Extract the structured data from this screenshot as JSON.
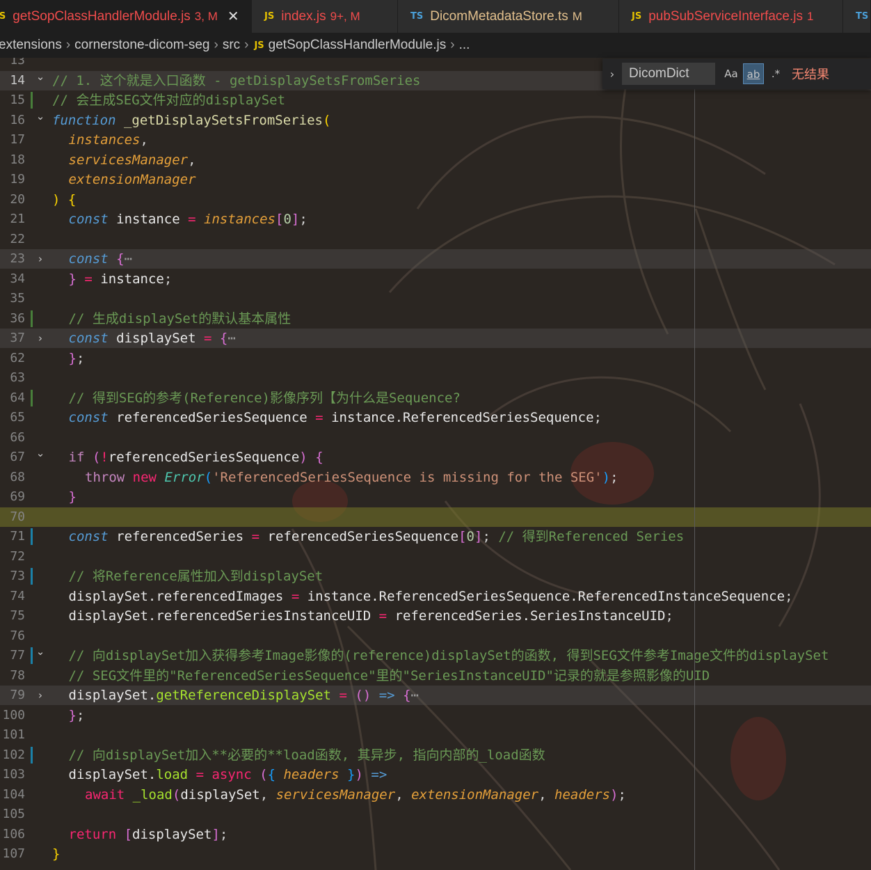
{
  "tabs": [
    {
      "icon": "JS",
      "name": "getSopClassHandlerModule.js",
      "status": "3, M",
      "state": "err",
      "active": true,
      "closable": true
    },
    {
      "icon": "JS",
      "name": "index.js",
      "status": "9+, M",
      "state": "err",
      "active": false
    },
    {
      "icon": "TS",
      "name": "DicomMetadataStore.ts",
      "status": "M",
      "state": "mod",
      "active": false
    },
    {
      "icon": "JS",
      "name": "pubSubServiceInterface.js",
      "status": "1",
      "state": "err",
      "active": false
    },
    {
      "icon": "TS",
      "name": "",
      "status": "",
      "state": "mod",
      "active": false
    }
  ],
  "tab_close_glyph": "✕",
  "breadcrumb": {
    "items": [
      "extensions",
      "cornerstone-dicom-seg",
      "src"
    ],
    "file_icon": "JS",
    "file": "getSopClassHandlerModule.js",
    "separator": "›",
    "trailing": "..."
  },
  "find_widget": {
    "query": "DicomDict",
    "match_case_label": "Aa",
    "whole_word_label": "ab",
    "regex_label": ".*",
    "result_text": "无结果",
    "expand_icon": "chevron-right-icon"
  },
  "colors": {
    "editor_bg": "#1e1e1e",
    "accent": "#007acc",
    "error_tab": "#f14c4c",
    "modified_tab": "#e2c08d"
  },
  "editor": {
    "current_line": 14,
    "lines": [
      {
        "n": "13",
        "cls": "partial",
        "tokens": []
      },
      {
        "n": "14",
        "fold": "open",
        "hl": "hl",
        "tokens": [
          [
            "t-cm",
            "// 1. 这个就是入口函数 - getDisplaySetsFromSeries"
          ]
        ]
      },
      {
        "n": "15",
        "gm": "add",
        "tokens": [
          [
            "t-cm",
            "// 会生成SEG文件对应的displaySet"
          ]
        ]
      },
      {
        "n": "16",
        "fold": "open",
        "tokens": [
          [
            "t-kw",
            "function"
          ],
          [
            "t-op",
            " "
          ],
          [
            "t-fn",
            "_getDisplaySetsFromSeries"
          ],
          [
            "t-br1",
            "("
          ]
        ]
      },
      {
        "n": "17",
        "ind": 1,
        "tokens": [
          [
            "t-prm",
            "instances"
          ],
          [
            "t-op",
            ","
          ]
        ]
      },
      {
        "n": "18",
        "ind": 1,
        "tokens": [
          [
            "t-prm",
            "servicesManager"
          ],
          [
            "t-op",
            ","
          ]
        ]
      },
      {
        "n": "19",
        "ind": 1,
        "tokens": [
          [
            "t-prm",
            "extensionManager"
          ]
        ]
      },
      {
        "n": "20",
        "tokens": [
          [
            "t-br1",
            ")"
          ],
          [
            "t-op",
            " "
          ],
          [
            "t-br1",
            "{"
          ]
        ]
      },
      {
        "n": "21",
        "ind": 1,
        "tokens": [
          [
            "t-kw",
            "const"
          ],
          [
            "t-op",
            " "
          ],
          [
            "t-var",
            "instance"
          ],
          [
            "t-op",
            " "
          ],
          [
            "t-pink",
            "="
          ],
          [
            "t-op",
            " "
          ],
          [
            "t-prm",
            "instances"
          ],
          [
            "t-br2",
            "["
          ],
          [
            "t-num",
            "0"
          ],
          [
            "t-br2",
            "]"
          ],
          [
            "t-op",
            ";"
          ]
        ]
      },
      {
        "n": "22",
        "ind": 1,
        "tokens": []
      },
      {
        "n": "23",
        "fold": "closed",
        "hl": "hl",
        "ind": 1,
        "tokens": [
          [
            "t-kw",
            "const"
          ],
          [
            "t-op",
            " "
          ],
          [
            "t-br2",
            "{"
          ],
          [
            "ellip",
            "⋯"
          ]
        ]
      },
      {
        "n": "34",
        "ind": 1,
        "tokens": [
          [
            "t-br2",
            "}"
          ],
          [
            "t-op",
            " "
          ],
          [
            "t-pink",
            "="
          ],
          [
            "t-op",
            " "
          ],
          [
            "t-var",
            "instance"
          ],
          [
            "t-op",
            ";"
          ]
        ]
      },
      {
        "n": "35",
        "ind": 1,
        "tokens": []
      },
      {
        "n": "36",
        "gm": "add",
        "ind": 1,
        "tokens": [
          [
            "t-cm",
            "// 生成displaySet的默认基本属性"
          ]
        ]
      },
      {
        "n": "37",
        "fold": "closed",
        "hl": "hl",
        "ind": 1,
        "tokens": [
          [
            "t-kw",
            "const"
          ],
          [
            "t-op",
            " "
          ],
          [
            "t-var",
            "displaySet"
          ],
          [
            "t-op",
            " "
          ],
          [
            "t-pink",
            "="
          ],
          [
            "t-op",
            " "
          ],
          [
            "t-br2",
            "{"
          ],
          [
            "ellip",
            "⋯"
          ]
        ]
      },
      {
        "n": "62",
        "ind": 1,
        "tokens": [
          [
            "t-br2",
            "}"
          ],
          [
            "t-op",
            ";"
          ]
        ]
      },
      {
        "n": "63",
        "ind": 1,
        "tokens": []
      },
      {
        "n": "64",
        "gm": "add",
        "ind": 1,
        "tokens": [
          [
            "t-cm",
            "// 得到SEG的参考(Reference)影像序列【为什么是Sequence?"
          ]
        ]
      },
      {
        "n": "65",
        "ind": 1,
        "tokens": [
          [
            "t-kw",
            "const"
          ],
          [
            "t-op",
            " "
          ],
          [
            "t-var",
            "referencedSeriesSequence"
          ],
          [
            "t-op",
            " "
          ],
          [
            "t-pink",
            "="
          ],
          [
            "t-op",
            " "
          ],
          [
            "t-var",
            "instance.ReferencedSeriesSequence"
          ],
          [
            "t-op",
            ";"
          ]
        ]
      },
      {
        "n": "66",
        "ind": 1,
        "tokens": []
      },
      {
        "n": "67",
        "fold": "open",
        "ind": 1,
        "tokens": [
          [
            "t-ctl",
            "if"
          ],
          [
            "t-op",
            " "
          ],
          [
            "t-br2",
            "("
          ],
          [
            "t-pink",
            "!"
          ],
          [
            "t-var",
            "referencedSeriesSequence"
          ],
          [
            "t-br2",
            ")"
          ],
          [
            "t-op",
            " "
          ],
          [
            "t-br2",
            "{"
          ]
        ]
      },
      {
        "n": "68",
        "ind": 2,
        "tokens": [
          [
            "t-ctl",
            "throw"
          ],
          [
            "t-op",
            " "
          ],
          [
            "t-red",
            "new"
          ],
          [
            "t-op",
            " "
          ],
          [
            "t-cls",
            "Error"
          ],
          [
            "t-br3",
            "("
          ],
          [
            "t-str",
            "'ReferencedSeriesSequence is missing for the SEG'"
          ],
          [
            "t-br3",
            ")"
          ],
          [
            "t-op",
            ";"
          ]
        ]
      },
      {
        "n": "69",
        "ind": 1,
        "tokens": [
          [
            "t-br2",
            "}"
          ]
        ]
      },
      {
        "n": "70",
        "hl": "yhl",
        "tokens": []
      },
      {
        "n": "71",
        "gm": "mod",
        "ind": 1,
        "tokens": [
          [
            "t-kw",
            "const"
          ],
          [
            "t-op",
            " "
          ],
          [
            "t-var",
            "referencedSeries"
          ],
          [
            "t-op",
            " "
          ],
          [
            "t-pink",
            "="
          ],
          [
            "t-op",
            " "
          ],
          [
            "t-var",
            "referencedSeriesSequence"
          ],
          [
            "t-br2",
            "["
          ],
          [
            "t-num",
            "0"
          ],
          [
            "t-br2",
            "]"
          ],
          [
            "t-op",
            ";"
          ],
          [
            "t-op",
            " "
          ],
          [
            "t-cm",
            "// 得到Referenced Series"
          ]
        ]
      },
      {
        "n": "72",
        "ind": 1,
        "tokens": []
      },
      {
        "n": "73",
        "gm": "mod",
        "ind": 1,
        "tokens": [
          [
            "t-cm",
            "// 将Reference属性加入到displaySet"
          ]
        ]
      },
      {
        "n": "74",
        "ind": 1,
        "tokens": [
          [
            "t-var",
            "displaySet.referencedImages"
          ],
          [
            "t-op",
            " "
          ],
          [
            "t-pink",
            "="
          ],
          [
            "t-op",
            " "
          ],
          [
            "t-var",
            "instance.ReferencedSeriesSequence.ReferencedInstanceSequence"
          ],
          [
            "t-op",
            ";"
          ]
        ]
      },
      {
        "n": "75",
        "ind": 1,
        "tokens": [
          [
            "t-var",
            "displaySet.referencedSeriesInstanceUID"
          ],
          [
            "t-op",
            " "
          ],
          [
            "t-pink",
            "="
          ],
          [
            "t-op",
            " "
          ],
          [
            "t-var",
            "referencedSeries.SeriesInstanceUID"
          ],
          [
            "t-op",
            ";"
          ]
        ]
      },
      {
        "n": "76",
        "ind": 1,
        "tokens": []
      },
      {
        "n": "77",
        "fold": "open",
        "gm": "mod",
        "ind": 1,
        "tokens": [
          [
            "t-cm",
            "// 向displaySet加入获得参考Image影像的(reference)displaySet的函数, 得到SEG文件参考Image文件的displaySet"
          ]
        ]
      },
      {
        "n": "78",
        "ind": 1,
        "tokens": [
          [
            "t-cm",
            "// SEG文件里的\"ReferencedSeriesSequence\"里的\"SeriesInstanceUID\"记录的就是参照影像的UID"
          ]
        ]
      },
      {
        "n": "79",
        "fold": "closed",
        "hl": "hl",
        "ind": 1,
        "tokens": [
          [
            "t-var",
            "displaySet."
          ],
          [
            "t-grn",
            "getReferenceDisplaySet"
          ],
          [
            "t-op",
            " "
          ],
          [
            "t-pink",
            "="
          ],
          [
            "t-op",
            " "
          ],
          [
            "t-br2",
            "()"
          ],
          [
            "t-op",
            " "
          ],
          [
            "t-kw",
            "=>"
          ],
          [
            "t-op",
            " "
          ],
          [
            "t-br2",
            "{"
          ],
          [
            "ellip",
            "⋯"
          ]
        ]
      },
      {
        "n": "100",
        "ind": 1,
        "tokens": [
          [
            "t-br2",
            "}"
          ],
          [
            "t-op",
            ";"
          ]
        ]
      },
      {
        "n": "101",
        "ind": 1,
        "tokens": []
      },
      {
        "n": "102",
        "gm": "mod",
        "ind": 1,
        "tokens": [
          [
            "t-cm",
            "// 向displaySet加入**必要的**load函数, 其异步, 指向内部的_load函数"
          ]
        ]
      },
      {
        "n": "103",
        "ind": 1,
        "tokens": [
          [
            "t-var",
            "displaySet."
          ],
          [
            "t-grn",
            "load"
          ],
          [
            "t-op",
            " "
          ],
          [
            "t-pink",
            "="
          ],
          [
            "t-op",
            " "
          ],
          [
            "t-red",
            "async"
          ],
          [
            "t-op",
            " "
          ],
          [
            "t-br2",
            "("
          ],
          [
            "t-br3",
            "{"
          ],
          [
            "t-op",
            " "
          ],
          [
            "t-prm",
            "headers"
          ],
          [
            "t-op",
            " "
          ],
          [
            "t-br3",
            "}"
          ],
          [
            "t-br2",
            ")"
          ],
          [
            "t-op",
            " "
          ],
          [
            "t-kw",
            "=>"
          ]
        ]
      },
      {
        "n": "104",
        "ind": 2,
        "tokens": [
          [
            "t-red",
            "await"
          ],
          [
            "t-op",
            " "
          ],
          [
            "t-grn",
            "_load"
          ],
          [
            "t-br2",
            "("
          ],
          [
            "t-var",
            "displaySet"
          ],
          [
            "t-op",
            ", "
          ],
          [
            "t-prm",
            "servicesManager"
          ],
          [
            "t-op",
            ", "
          ],
          [
            "t-prm",
            "extensionManager"
          ],
          [
            "t-op",
            ", "
          ],
          [
            "t-prm",
            "headers"
          ],
          [
            "t-br2",
            ")"
          ],
          [
            "t-op",
            ";"
          ]
        ]
      },
      {
        "n": "105",
        "ind": 2,
        "tokens": []
      },
      {
        "n": "106",
        "ind": 1,
        "tokens": [
          [
            "t-red",
            "return"
          ],
          [
            "t-op",
            " "
          ],
          [
            "t-br2",
            "["
          ],
          [
            "t-var",
            "displaySet"
          ],
          [
            "t-br2",
            "]"
          ],
          [
            "t-op",
            ";"
          ]
        ]
      },
      {
        "n": "107",
        "tokens": [
          [
            "t-br1",
            "}"
          ]
        ]
      }
    ]
  }
}
